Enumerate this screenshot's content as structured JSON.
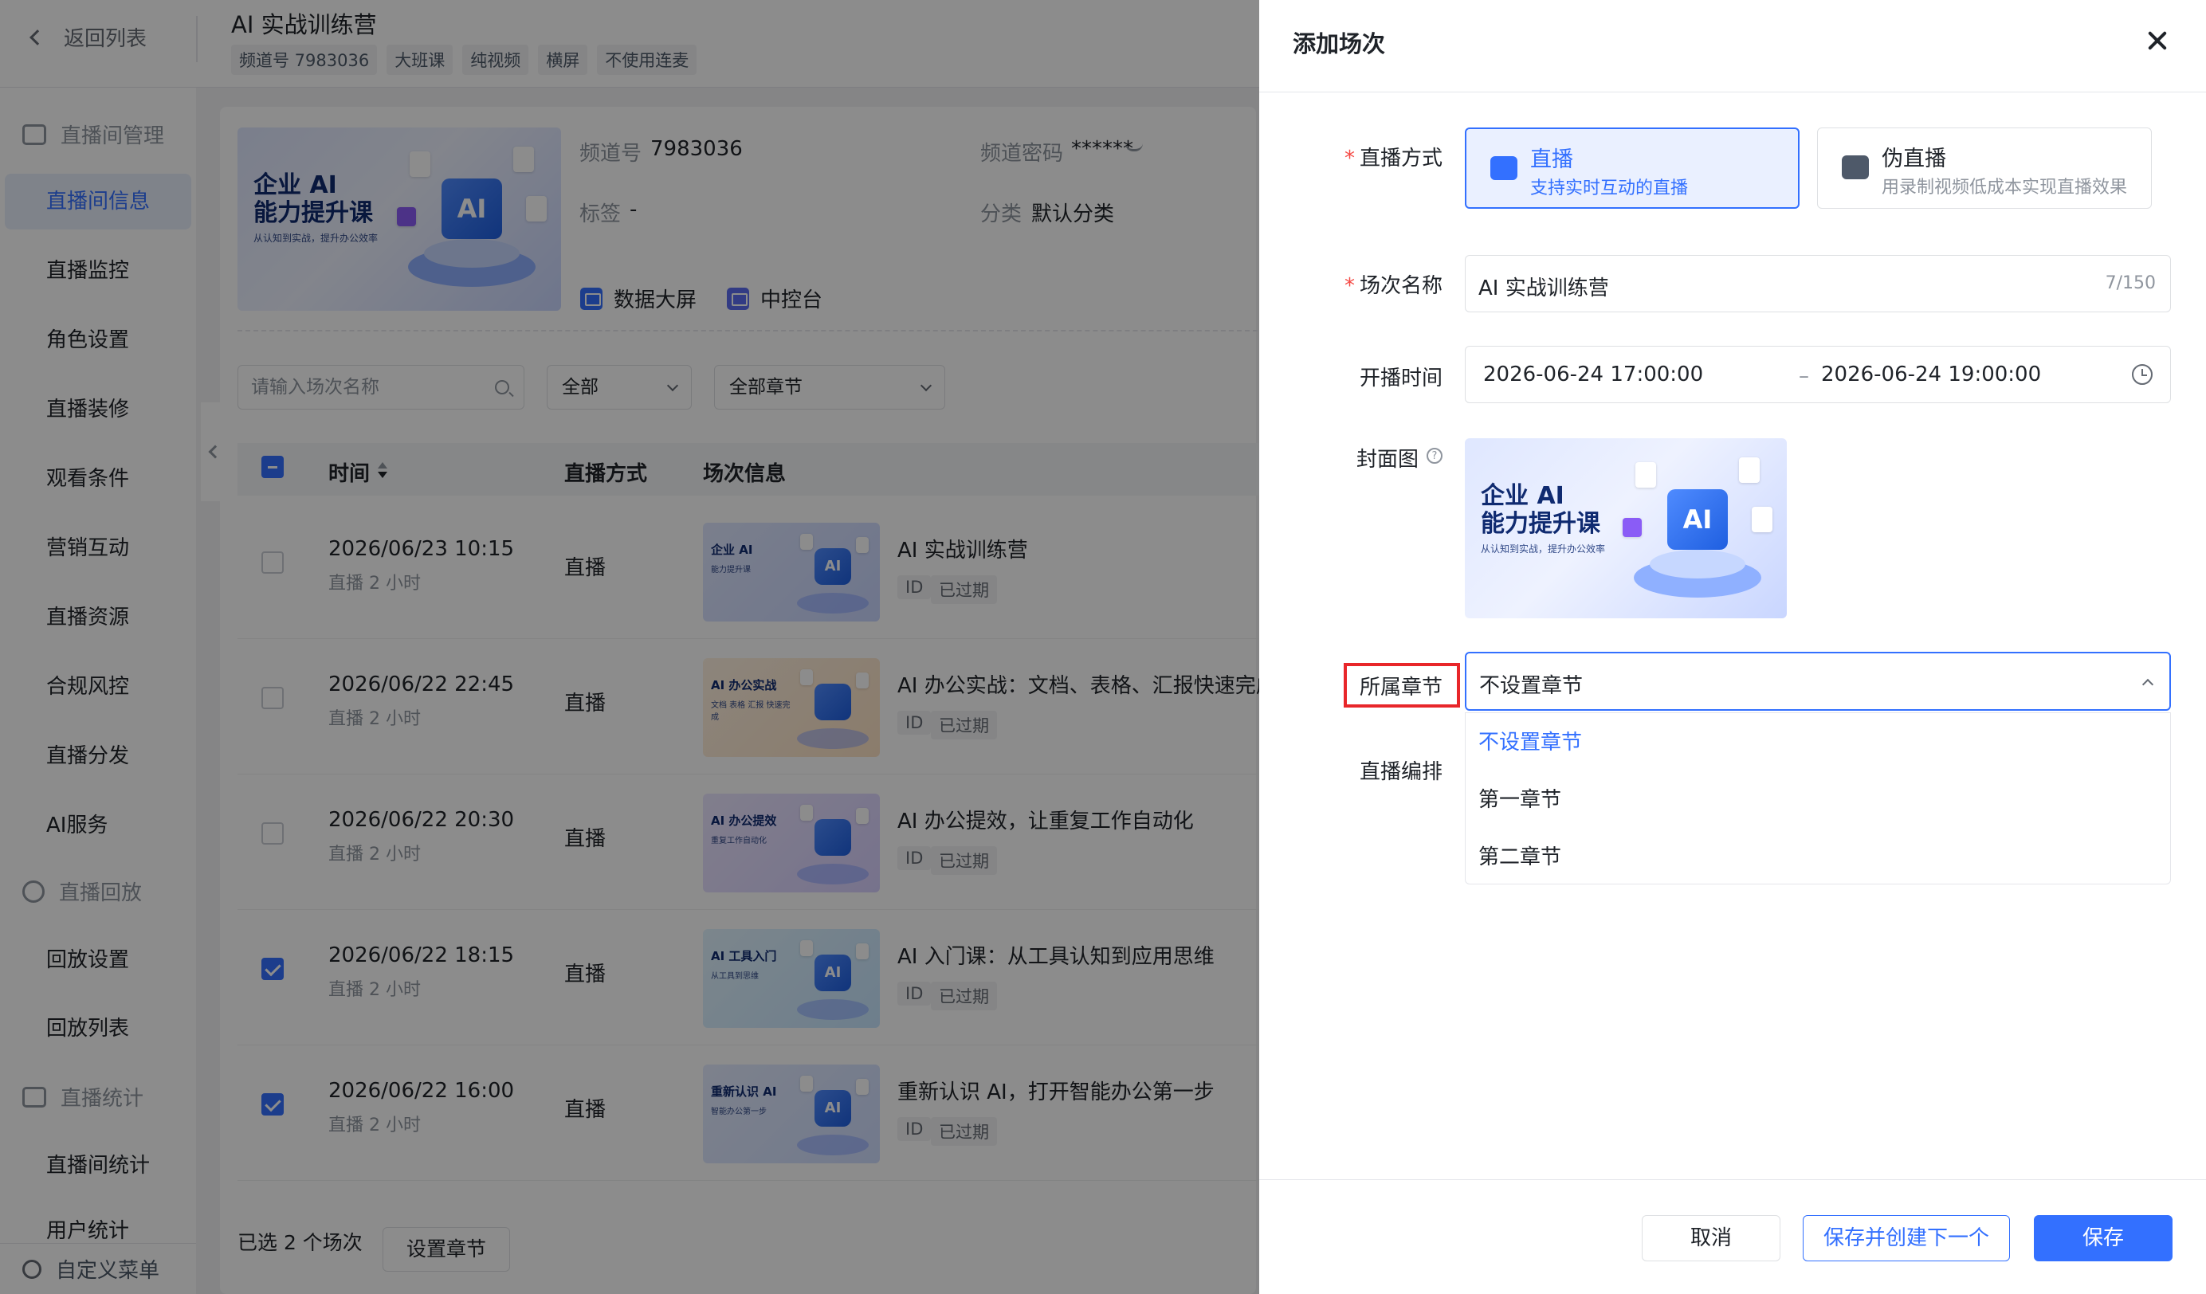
{
  "topbar": {
    "back_label": "返回列表",
    "room_title": "AI 实战训练营",
    "tags": [
      "频道号 7983036",
      "大班课",
      "纯视频",
      "横屏",
      "不使用连麦"
    ]
  },
  "sidebar": {
    "groups": {
      "room_manage": "直播间管理",
      "playback": "直播回放",
      "stats": "直播统计"
    },
    "items": [
      "直播间信息",
      "直播监控",
      "角色设置",
      "直播装修",
      "观看条件",
      "营销互动",
      "直播资源",
      "合规风控",
      "直播分发",
      "AI服务"
    ],
    "playback_items": [
      "回放设置",
      "回放列表"
    ],
    "stats_items": [
      "直播间统计",
      "用户统计"
    ],
    "bottom": "自定义菜单"
  },
  "room_info": {
    "cover": {
      "line1": "企业 AI",
      "line2": "能力提升课",
      "sub": "从认知到实战，提升办公效率",
      "badge": "AI"
    },
    "channel_label": "频道号",
    "channel_value": "7983036",
    "password_label": "频道密码",
    "password_value": "******",
    "tag_label": "标签",
    "tag_value": "-",
    "category_label": "分类",
    "category_value": "默认分类",
    "quick_data": "数据大屏",
    "quick_console": "中控台"
  },
  "filters": {
    "search_placeholder": "请输入场次名称",
    "status_value": "全部",
    "chapter_value": "全部章节"
  },
  "table": {
    "headers": {
      "time": "时间",
      "mode": "直播方式",
      "info": "场次信息"
    },
    "rows": [
      {
        "date": "2026/06/23 10:15",
        "dur": "直播 2 小时",
        "mode": "直播",
        "title": "AI 实战训练营",
        "id": "ID",
        "status": "已过期",
        "checked": false,
        "thumb": {
          "line1": "企业 AI",
          "line2": "能力提升课",
          "badge": "AI"
        }
      },
      {
        "date": "2026/06/22 22:45",
        "dur": "直播 2 小时",
        "mode": "直播",
        "title": "AI 办公实战：文档、表格、汇报快速完成",
        "id": "ID",
        "status": "已过期",
        "checked": false,
        "thumb": {
          "line1": "AI 办公实战",
          "line2": "文档 表格 汇报 快速完成",
          "badge": ""
        }
      },
      {
        "date": "2026/06/22 20:30",
        "dur": "直播 2 小时",
        "mode": "直播",
        "title": "AI 办公提效，让重复工作自动化",
        "id": "ID",
        "status": "已过期",
        "checked": false,
        "thumb": {
          "line1": "AI 办公提效",
          "line2": "重复工作自动化",
          "badge": ""
        }
      },
      {
        "date": "2026/06/22 18:15",
        "dur": "直播 2 小时",
        "mode": "直播",
        "title": "AI 入门课：从工具认知到应用思维",
        "id": "ID",
        "status": "已过期",
        "checked": true,
        "thumb": {
          "line1": "AI 工具入门",
          "line2": "从工具到思维",
          "badge": "AI"
        }
      },
      {
        "date": "2026/06/22 16:00",
        "dur": "直播 2 小时",
        "mode": "直播",
        "title": "重新认识 AI，打开智能办公第一步",
        "id": "ID",
        "status": "已过期",
        "checked": true,
        "thumb": {
          "line1": "重新认识 AI",
          "line2": "智能办公第一步",
          "badge": "AI"
        }
      }
    ]
  },
  "bulk": {
    "selected_text": "已选 2 个场次",
    "set_chapter": "设置章节"
  },
  "drawer": {
    "title": "添加场次",
    "mode_label": "直播方式",
    "modes": [
      {
        "title": "直播",
        "desc": "支持实时互动的直播",
        "selected": true
      },
      {
        "title": "伪直播",
        "desc": "用录制视频低成本实现直播效果",
        "selected": false
      }
    ],
    "name_label": "场次名称",
    "name_value": "AI 实战训练营",
    "name_count": "7/150",
    "time_label": "开播时间",
    "time_start": "2026-06-24 17:00:00",
    "time_sep": "–",
    "time_end": "2026-06-24 19:00:00",
    "cover_label": "封面图",
    "cover": {
      "line1": "企业 AI",
      "line2": "能力提升课",
      "sub": "从认知到实战，提升办公效率",
      "badge": "AI"
    },
    "chapter_label": "所属章节",
    "chapter_value": "不设置章节",
    "chapter_options": [
      "不设置章节",
      "第一章节",
      "第二章节"
    ],
    "arrange_label": "直播编排",
    "cancel": "取消",
    "save_next": "保存并创建下一个",
    "save": "保存"
  },
  "colors": {
    "primary": "#3370ff",
    "danger": "#f54a45",
    "highlight_box": "#e8262a"
  }
}
